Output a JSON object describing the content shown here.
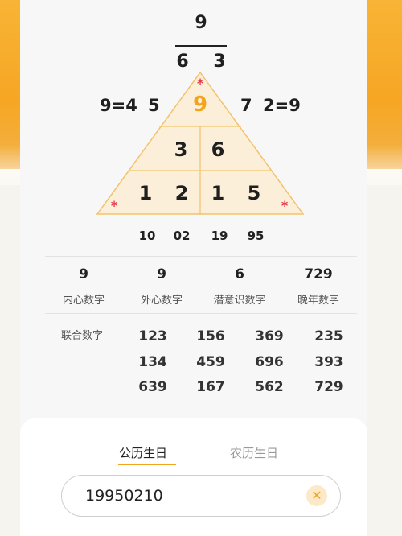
{
  "pyramid": {
    "top_number": "9",
    "second_row": [
      "6",
      "3"
    ],
    "left_sum": "9=4",
    "left_digit": "5",
    "right_digit": "7",
    "right_sum": "2=9",
    "apex": "9",
    "row1": [
      "3",
      "6"
    ],
    "row2": [
      "1",
      "2",
      "1",
      "5"
    ],
    "birth_parts": [
      "10",
      "02",
      "19",
      "95"
    ],
    "marker_symbol": "*"
  },
  "stats": [
    {
      "value": "9",
      "label": "内心数字"
    },
    {
      "value": "9",
      "label": "外心数字"
    },
    {
      "value": "6",
      "label": "潜意识数字"
    },
    {
      "value": "729",
      "label": "晚年数字"
    }
  ],
  "combo": {
    "label": "联合数字",
    "rows": [
      [
        "123",
        "156",
        "369",
        "235"
      ],
      [
        "134",
        "459",
        "696",
        "393"
      ],
      [
        "639",
        "167",
        "562",
        "729"
      ]
    ]
  },
  "tabs": [
    {
      "label": "公历生日",
      "active": true
    },
    {
      "label": "农历生日",
      "active": false
    }
  ],
  "input": {
    "value": "19950210",
    "clear_icon": "close-icon"
  },
  "colors": {
    "accent": "#f2a51c",
    "pyramid_fill": "#fcefd9",
    "marker": "#e23a4a"
  }
}
